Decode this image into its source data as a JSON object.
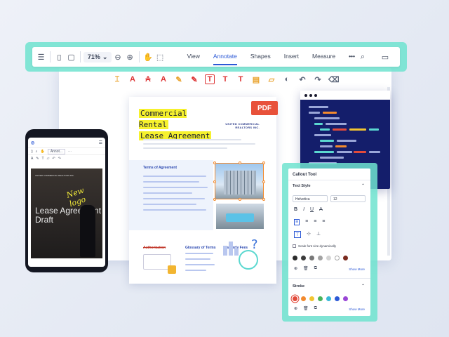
{
  "toolbar": {
    "zoom": "71%",
    "tabs": [
      "View",
      "Annotate",
      "Shapes",
      "Insert",
      "Measure"
    ],
    "active_tab": "Annotate",
    "more": "•••"
  },
  "document": {
    "title_line1": "Commercial Rental",
    "title_line2": "Lease Agreement",
    "badge": "PDF",
    "company": "UNITED COMMERCIAL REALTORS INC.",
    "section_terms": "Terms of Agreement",
    "authorization": "Authorization",
    "glossary": "Glossary of Terms",
    "quarterly": "Quarterly Fees",
    "qmark": "?"
  },
  "phone": {
    "select_label": "Annot...",
    "company": "UNITED COMMERCIAL REALTORS INC.",
    "title": "Lease Agreement Draft",
    "annotation": "New logo"
  },
  "callout": {
    "title": "Callout Tool",
    "text_style": "Text Style",
    "font": "Helvetica",
    "size": "12",
    "scale_label": "Scale font size dynamically",
    "show_more": "Show More",
    "stroke": "Stroke",
    "text_colors": [
      "#2b2b2b",
      "#3b3b3b",
      "#777777",
      "#a3a3a3",
      "#d4d4d4",
      "#ffffff",
      "#7a2b1f"
    ],
    "stroke_colors": [
      "#e24b3b",
      "#f28a2e",
      "#f2c531",
      "#49b35a",
      "#38b8d8",
      "#2c59d6",
      "#9a46d6"
    ]
  }
}
